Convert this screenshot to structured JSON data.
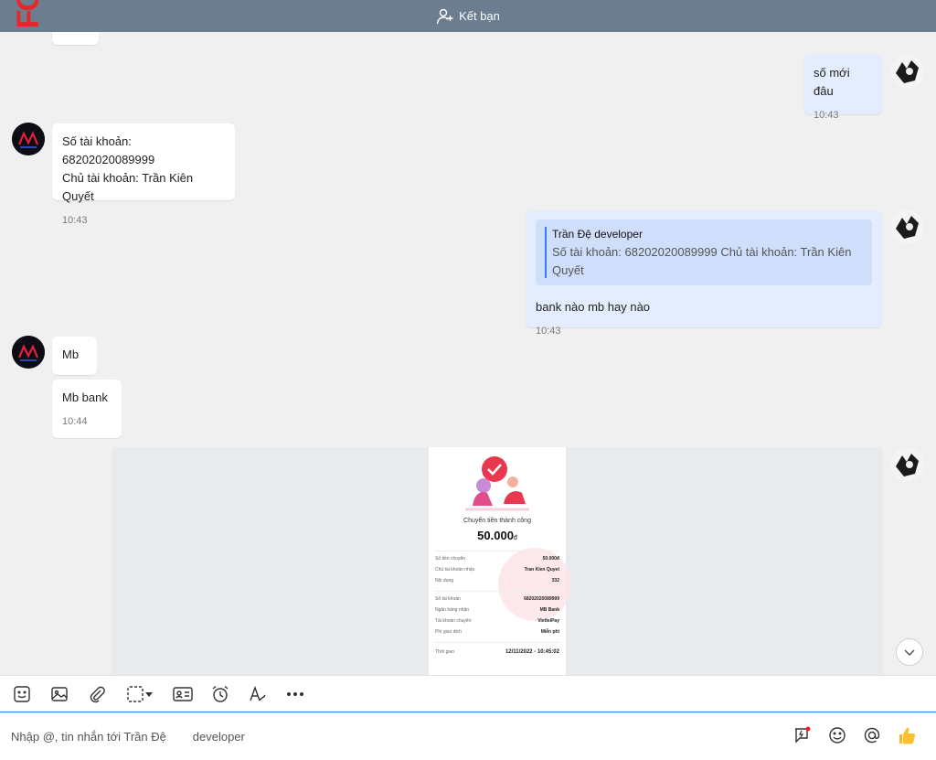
{
  "header": {
    "add_friend_label": "Kết bạn"
  },
  "messages": {
    "m1": {
      "text": "số mới đâu",
      "time": "10:43"
    },
    "m2": {
      "line1": "Số tài khoản: 68202020089999",
      "line2": "Chủ tài khoản: Trần Kiên Quyết",
      "time": "10:43"
    },
    "m3": {
      "quote_name": "Trần Đệ        developer",
      "quote_text": "Số tài khoản: 68202020089999 Chủ tài khoản: Trần Kiên Quyết",
      "text": "bank nào mb hay nào",
      "time": "10:43"
    },
    "m4": {
      "text": "Mb"
    },
    "m5": {
      "text": "Mb bank",
      "time": "10:44"
    }
  },
  "receipt": {
    "title": "Chuyển tiền thành công",
    "amount": "50.000",
    "currency": "đ",
    "rows1": [
      {
        "label": "Số tiền chuyển",
        "value": "50.000đ"
      },
      {
        "label": "Chủ tài khoản nhận",
        "value": "Tran Kien Quyet"
      },
      {
        "label": "Nội dung",
        "value": "332"
      }
    ],
    "rows2": [
      {
        "label": "Số tài khoản",
        "value": "68202020089999"
      },
      {
        "label": "Ngân hàng nhận",
        "value": "MB Bank"
      },
      {
        "label": "Tài khoản chuyển",
        "value": "ViettelPay"
      },
      {
        "label": "Phí giao dịch",
        "value": "Miễn phí"
      }
    ],
    "time_label": "Thời gian",
    "time_value": "12/11/2022 - 10:45:02"
  },
  "composer": {
    "placeholder": "Nhập @, tin nhắn tới Trần Đệ        developer"
  },
  "colors": {
    "header_bg": "#6b7d8f",
    "out_bubble": "#e4edfd",
    "in_bubble": "#ffffff",
    "accent": "#3b7bf5"
  }
}
